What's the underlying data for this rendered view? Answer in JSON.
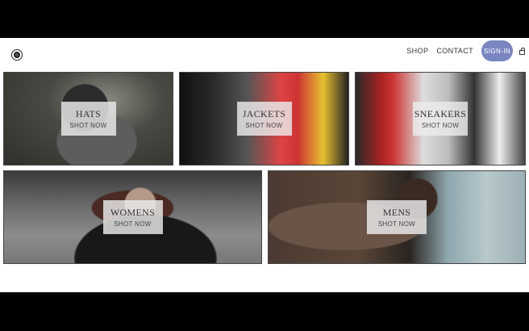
{
  "header": {
    "nav": {
      "shop": "SHOP",
      "contact": "CONTACT",
      "signin": "SIGN-IN"
    }
  },
  "categories": [
    {
      "title": "HATS",
      "cta": "SHOT NOW"
    },
    {
      "title": "JACKETS",
      "cta": "SHOT NOW"
    },
    {
      "title": "SNEAKERS",
      "cta": "SHOT NOW"
    },
    {
      "title": "WOMENS",
      "cta": "SHOT NOW"
    },
    {
      "title": "MENS",
      "cta": "SHOT NOW"
    }
  ],
  "colors": {
    "signin_bg": "#7a86c2",
    "label_box": "#ebebeb"
  }
}
